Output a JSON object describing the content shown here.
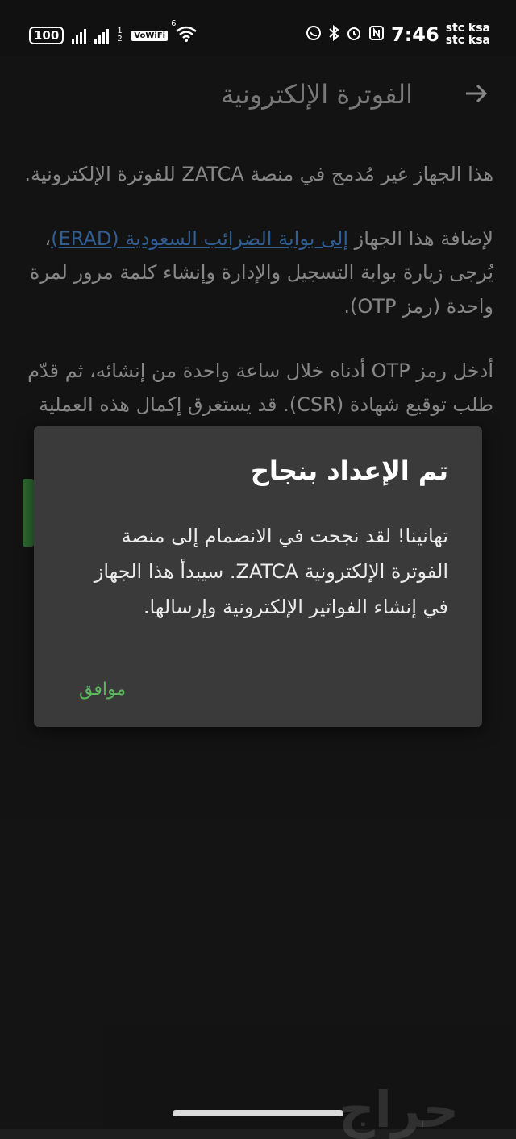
{
  "status_bar": {
    "battery": "100",
    "sim_indicator": "1 2",
    "vowifi": "VoWiFi",
    "wifi_badge": "6",
    "time": "7:46",
    "carrier_1": "stc ksa",
    "carrier_2": "stc ksa",
    "icons": [
      "whatsapp-icon",
      "bluetooth-icon",
      "alarm-icon",
      "nfc-icon"
    ]
  },
  "header": {
    "title": "الفوترة الإلكترونية",
    "back_icon": "arrow-back-icon"
  },
  "body": {
    "paragraph_1": "هذا الجهاز غير مُدمج في منصة ZATCA للفوترة الإلكترونية.",
    "paragraph_2_prefix": "لإضافة هذا الجهاز",
    "paragraph_2_link": "إلى بوابة الضرائب السعودية (ERAD)",
    "paragraph_2_suffix": "، يُرجى زيارة بوابة التسجيل والإدارة وإنشاء كلمة مرور لمرة واحدة (رمز OTP).",
    "paragraph_3": "أدخل رمز OTP أدناه خلال ساعة واحدة من إنشائه، ثم قدّم طلب توقيع شهادة (CSR). قد يستغرق إكمال هذه العملية"
  },
  "dialog": {
    "title": "تم الإعداد بنجاح",
    "message": "تهانينا! لقد نجحت في الانضمام إلى منصة الفوترة الإلكترونية ZATCA. سيبدأ هذا الجهاز في إنشاء الفواتير الإلكترونية وإرسالها.",
    "ok_label": "موافق"
  },
  "watermark": "حراج",
  "colors": {
    "accent_green": "#4caf50",
    "link_blue": "#4a8fe0",
    "dialog_bg": "#3a3a3a",
    "page_bg": "#1e1e1e"
  }
}
